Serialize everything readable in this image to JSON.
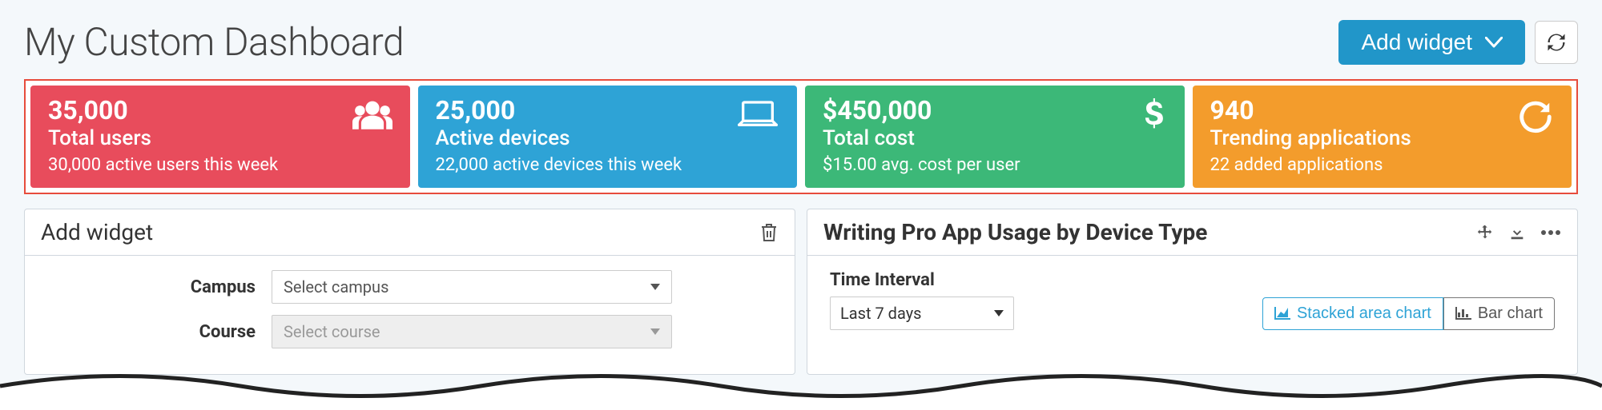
{
  "header": {
    "title": "My Custom Dashboard",
    "add_widget_label": "Add widget"
  },
  "cards": [
    {
      "value": "35,000",
      "label": "Total users",
      "sub": "30,000 active users this week",
      "color": "red",
      "icon": "users-icon"
    },
    {
      "value": "25,000",
      "label": "Active devices",
      "sub": "22,000 active devices this week",
      "color": "blue",
      "icon": "laptop-icon"
    },
    {
      "value": "$450,000",
      "label": "Total cost",
      "sub": "$15.00 avg. cost per user",
      "color": "green",
      "icon": "dollar-icon"
    },
    {
      "value": "940",
      "label": "Trending applications",
      "sub": "22 added applications",
      "color": "orange",
      "icon": "reload-icon"
    }
  ],
  "left_panel": {
    "title": "Add widget",
    "campus": {
      "label": "Campus",
      "value": "Select campus"
    },
    "course": {
      "label": "Course",
      "value": "Select course"
    }
  },
  "right_panel": {
    "title": "Writing Pro App Usage by Device Type",
    "time_interval": {
      "label": "Time Interval",
      "value": "Last 7 days"
    },
    "chart_toggle": {
      "stacked": "Stacked area chart",
      "bar": "Bar chart"
    }
  }
}
